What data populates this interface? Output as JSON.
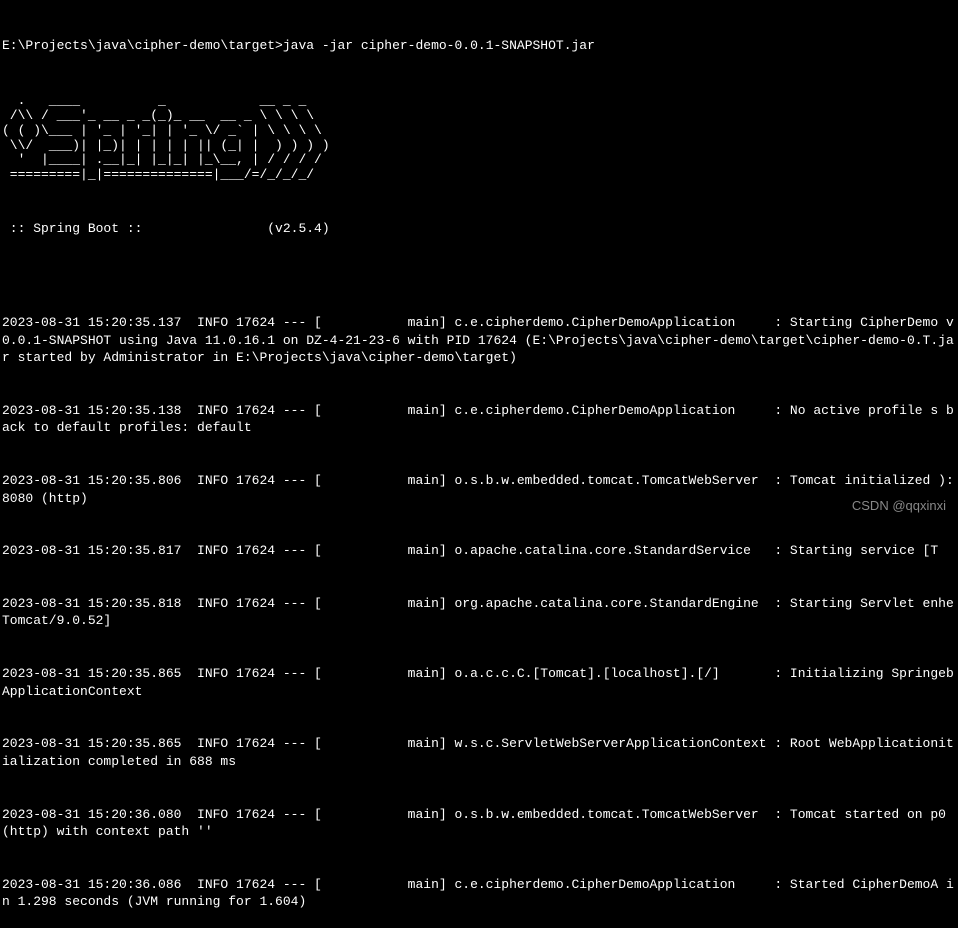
{
  "prompt": {
    "cwd": "E:\\Projects\\java\\cipher-demo\\target",
    "command": "java -jar cipher-demo-0.0.1-SNAPSHOT.jar"
  },
  "banner": {
    "ascii": "  .   ____          _            __ _ _\n /\\\\ / ___'_ __ _ _(_)_ __  __ _ \\ \\ \\ \\\n( ( )\\___ | '_ | '_| | '_ \\/ _` | \\ \\ \\ \\\n \\\\/  ___)| |_)| | | | | || (_| |  ) ) ) )\n  '  |____| .__|_| |_|_| |_\\__, | / / / /\n =========|_|==============|___/=/_/_/_/",
    "tag": " :: Spring Boot ::                (v2.5.4)"
  },
  "logs": [
    "2023-08-31 15:20:35.137  INFO 17624 --- [           main] c.e.cipherdemo.CipherDemoApplication     : Starting CipherDemo v0.0.1-SNAPSHOT using Java 11.0.16.1 on DZ-4-21-23-6 with PID 17624 (E:\\Projects\\java\\cipher-demo\\target\\cipher-demo-0.T.jar started by Administrator in E:\\Projects\\java\\cipher-demo\\target)",
    "2023-08-31 15:20:35.138  INFO 17624 --- [           main] c.e.cipherdemo.CipherDemoApplication     : No active profile s back to default profiles: default",
    "2023-08-31 15:20:35.806  INFO 17624 --- [           main] o.s.b.w.embedded.tomcat.TomcatWebServer  : Tomcat initialized ): 8080 (http)",
    "2023-08-31 15:20:35.817  INFO 17624 --- [           main] o.apache.catalina.core.StandardService   : Starting service [T",
    "2023-08-31 15:20:35.818  INFO 17624 --- [           main] org.apache.catalina.core.StandardEngine  : Starting Servlet enhe Tomcat/9.0.52]",
    "2023-08-31 15:20:35.865  INFO 17624 --- [           main] o.a.c.c.C.[Tomcat].[localhost].[/]       : Initializing SpringebApplicationContext",
    "2023-08-31 15:20:35.865  INFO 17624 --- [           main] w.s.c.ServletWebServerApplicationContext : Root WebApplicationitialization completed in 688 ms",
    "2023-08-31 15:20:36.080  INFO 17624 --- [           main] o.s.b.w.embedded.tomcat.TomcatWebServer  : Tomcat started on p0 (http) with context path ''",
    "2023-08-31 15:20:36.086  INFO 17624 --- [           main] c.e.cipherdemo.CipherDemoApplication     : Started CipherDemoA in 1.298 seconds (JVM running for 1.604)"
  ],
  "watermark": "CSDN @qqxinxi"
}
